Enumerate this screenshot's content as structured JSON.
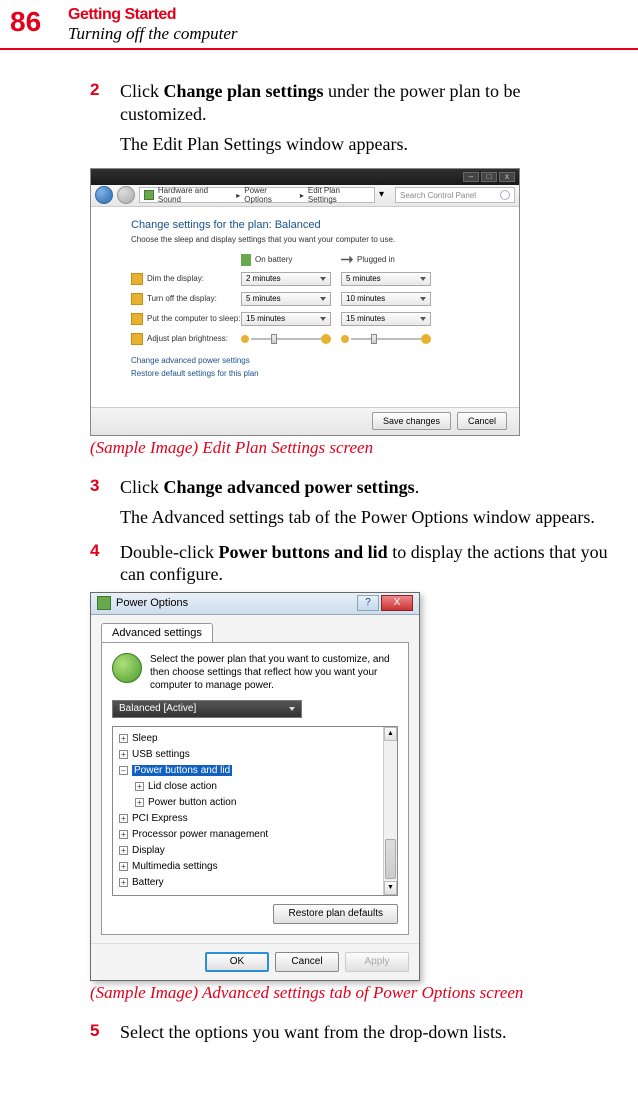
{
  "page_number": "86",
  "chapter": "Getting Started",
  "section": "Turning off the computer",
  "steps": {
    "s2": {
      "num": "2",
      "text_pre": "Click ",
      "bold": "Change plan settings",
      "text_post": " under the power plan to be customized."
    },
    "s2_follow": "The Edit Plan Settings window appears.",
    "s3": {
      "num": "3",
      "text_pre": "Click ",
      "bold": "Change advanced power settings",
      "text_post": "."
    },
    "s3_follow": "The Advanced settings tab of the Power Options window appears.",
    "s4": {
      "num": "4",
      "text_pre": "Double-click ",
      "bold": "Power buttons and lid",
      "text_post": " to display the actions that you can configure."
    },
    "s5": {
      "num": "5",
      "text": "Select the options you want from the drop-down lists."
    }
  },
  "captions": {
    "c1": "(Sample Image) Edit Plan Settings screen",
    "c2": "(Sample Image) Advanced settings tab of Power Options screen"
  },
  "win1": {
    "breadcrumb": [
      "Hardware and Sound",
      "Power Options",
      "Edit Plan Settings"
    ],
    "search_placeholder": "Search Control Panel",
    "heading": "Change settings for the plan: Balanced",
    "sub": "Choose the sleep and display settings that you want your computer to use.",
    "col_battery": "On battery",
    "col_plugged": "Plugged in",
    "rows": {
      "dim": {
        "label": "Dim the display:",
        "bat": "2 minutes",
        "plug": "5 minutes"
      },
      "off": {
        "label": "Turn off the display:",
        "bat": "5 minutes",
        "plug": "10 minutes"
      },
      "sleep": {
        "label": "Put the computer to sleep:",
        "bat": "15 minutes",
        "plug": "15 minutes"
      },
      "bright": {
        "label": "Adjust plan brightness:"
      }
    },
    "link_adv": "Change advanced power settings",
    "link_restore": "Restore default settings for this plan",
    "btn_save": "Save changes",
    "btn_cancel": "Cancel"
  },
  "dlg": {
    "title": "Power Options",
    "tab": "Advanced settings",
    "intro": "Select the power plan that you want to customize, and then choose settings that reflect how you want your computer to manage power.",
    "plan_selected": "Balanced [Active]",
    "tree": {
      "sleep": "Sleep",
      "usb": "USB settings",
      "pbl": "Power buttons and lid",
      "lid": "Lid close action",
      "pba": "Power button action",
      "pci": "PCI Express",
      "ppm": "Processor power management",
      "disp": "Display",
      "mm": "Multimedia settings",
      "bat": "Battery"
    },
    "restore": "Restore plan defaults",
    "ok": "OK",
    "cancel": "Cancel",
    "apply": "Apply"
  }
}
